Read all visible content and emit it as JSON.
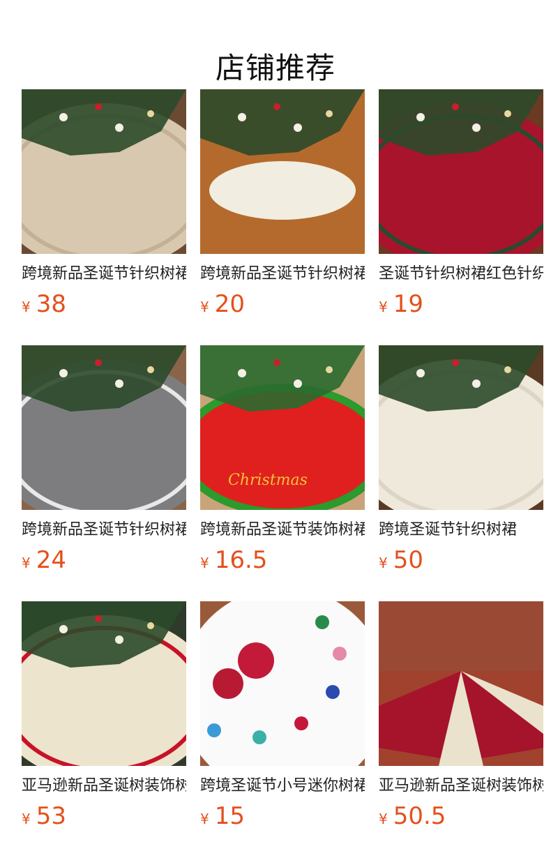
{
  "section": {
    "title": "店铺推荐"
  },
  "products": [
    {
      "name": "跨境新品圣诞节针织树裙",
      "currency": "¥",
      "price": "38",
      "image": "beige cable-knit tree skirt under snowy tree",
      "colors": [
        "#6b4a34",
        "#d8c8b0",
        "#c4b194"
      ]
    },
    {
      "name": "跨境新品圣诞节针织树裙",
      "currency": "¥",
      "price": "20",
      "image": "cream knit tree skirt on wooden floor",
      "colors": [
        "#b46a2c",
        "#f1ede0",
        "#2f5a3a"
      ]
    },
    {
      "name": "圣诞节针织树裙红色针织",
      "currency": "¥",
      "price": "19",
      "image": "red cable-knit tree skirt",
      "colors": [
        "#6a3a22",
        "#a8142c",
        "#2a4a30"
      ]
    },
    {
      "name": "跨境新品圣诞节针织树裙",
      "currency": "¥",
      "price": "24",
      "image": "grey cable-knit tree skirt",
      "colors": [
        "#8a6448",
        "#7d7d80",
        "#e8e8e8"
      ]
    },
    {
      "name": "跨境新品圣诞节装饰树裙",
      "currency": "¥",
      "price": "16.5",
      "image": "red elf-legs tree skirt with green scalloped edge",
      "colors": [
        "#c9a47a",
        "#e0201e",
        "#2c9a2c"
      ]
    },
    {
      "name": "跨境圣诞节针织树裙",
      "currency": "¥",
      "price": "50",
      "image": "white cable-knit tree skirt",
      "colors": [
        "#5a3a24",
        "#efe9dc",
        "#dcd4c4"
      ]
    },
    {
      "name": "亚马逊新品圣诞树装饰树裙",
      "currency": "¥",
      "price": "53",
      "image": "ivory knit tree skirt under decorated tree",
      "colors": [
        "#2f3a2a",
        "#ece4cc",
        "#c8122a"
      ]
    },
    {
      "name": "跨境圣诞节小号迷你树裙",
      "currency": "¥",
      "price": "15",
      "image": "white tree skirt with colorful paw prints",
      "colors": [
        "#9a5a3a",
        "#fafafa",
        "#c41a3a"
      ]
    },
    {
      "name": "亚马逊新品圣诞树装饰树裙",
      "currency": "¥",
      "price": "50.5",
      "image": "red and cream striped tree skirt with tassels",
      "colors": [
        "#a0422e",
        "#a5142a",
        "#eae2cc"
      ]
    }
  ]
}
